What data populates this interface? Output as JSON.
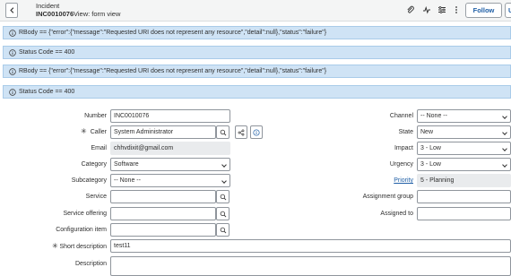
{
  "header": {
    "record_type": "Incident",
    "record_number": "INC0010076",
    "view_label": "View: form view",
    "follow_label": "Follow",
    "cut_button_label": "U",
    "icons": [
      "paperclip-icon",
      "activity-icon",
      "settings-sliders-icon",
      "more-icon"
    ]
  },
  "banners": [
    {
      "text": "RBody == {\"error\":{\"message\":\"Requested URI does not represent any resource\",\"detail\":null},\"status\":\"failure\"}"
    },
    {
      "text": "Status Code == 400"
    },
    {
      "text": "RBody == {\"error\":{\"message\":\"Requested URI does not represent any resource\",\"detail\":null},\"status\":\"failure\"}"
    },
    {
      "text": "Status Code == 400"
    }
  ],
  "form": {
    "number": {
      "label": "Number",
      "value": "INC0010076"
    },
    "caller": {
      "label": "Caller",
      "value": "System Administrator"
    },
    "email": {
      "label": "Email",
      "value": "chhvdixit@gmail.com"
    },
    "category": {
      "label": "Category",
      "value": "Software"
    },
    "subcategory": {
      "label": "Subcategory",
      "value": "-- None --"
    },
    "service": {
      "label": "Service",
      "value": ""
    },
    "service_offering": {
      "label": "Service offering",
      "value": ""
    },
    "configuration_item": {
      "label": "Configuration item",
      "value": ""
    },
    "short_description": {
      "label": "Short description",
      "value": "test11"
    },
    "description": {
      "label": "Description",
      "value": ""
    },
    "channel": {
      "label": "Channel",
      "value": "-- None --"
    },
    "state": {
      "label": "State",
      "value": "New"
    },
    "impact": {
      "label": "Impact",
      "value": "3 - Low"
    },
    "urgency": {
      "label": "Urgency",
      "value": "3 - Low"
    },
    "priority": {
      "label": "Priority",
      "value": "5 - Planning"
    },
    "assignment_group": {
      "label": "Assignment group",
      "value": ""
    },
    "assigned_to": {
      "label": "Assigned to",
      "value": ""
    },
    "required_marker": "✳"
  },
  "colors": {
    "banner_bg": "#cfe3f5",
    "link": "#1f5fa6",
    "readonly_bg": "#e9ebed"
  }
}
